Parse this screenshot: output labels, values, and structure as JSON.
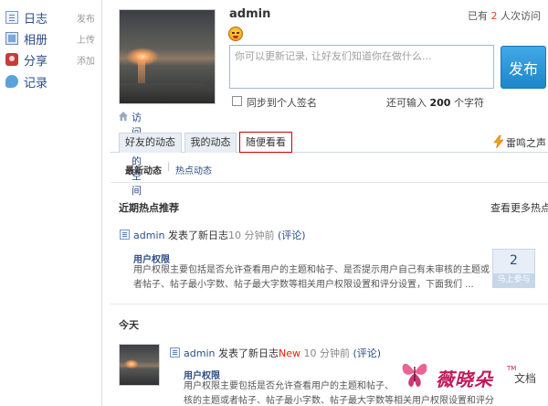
{
  "sidebar": {
    "items": [
      {
        "label": "日志",
        "action": "发布",
        "icon": "blog-icon"
      },
      {
        "label": "相册",
        "action": "上传",
        "icon": "album-icon"
      },
      {
        "label": "分享",
        "action": "添加",
        "icon": "share-icon"
      },
      {
        "label": "记录",
        "action": "",
        "icon": "record-icon"
      }
    ]
  },
  "profile": {
    "username": "admin",
    "visit_space": "访问我的空间",
    "visitors_prefix": "已有",
    "visitors_count": "2",
    "visitors_suffix": "人次访问"
  },
  "status": {
    "placeholder": "你可以更新记录, 让好友们知道你在做什么...",
    "publish_label": "发布",
    "sync_label": "同步到个人签名",
    "char_prefix": "还可输入",
    "char_count": "200",
    "char_suffix": "个字符"
  },
  "tabs": {
    "friends": "好友的动态",
    "mine": "我的动态",
    "random": "随便看看",
    "thunder": "雷鸣之声"
  },
  "subtabs": {
    "latest": "最新动态",
    "separator": "|",
    "hot": "热点动态"
  },
  "hot_section": {
    "title": "近期热点推荐",
    "more": "查看更多热点",
    "feed": {
      "user": "admin",
      "action": "发表了新日志",
      "time": "10 分钟前",
      "comment": "(评论)",
      "post_title": "用户权限",
      "post_body_1": "用户权限主要包括是否允许查看用户的主题和帖子、是否提示用户自己有未审核的主题或",
      "post_body_2": "者帖子、帖子最小字数、帖子最大字数等相关用户权限设置和评分设置，下面我们 ...",
      "vote_count": "2",
      "vote_label": "马上参与"
    }
  },
  "today_section": {
    "title": "今天",
    "feed": {
      "user": "admin",
      "action": "发表了新日志",
      "new_tag": "New",
      "time": "10 分钟前",
      "comment": "(评论)",
      "post_title": "用户权限",
      "post_body_1": "用户权限主要包括是否允许查看用户的主题和帖子、",
      "post_body_2": "核的主题或者帖子、帖子最小字数、帖子最大字数等相关用户权限设置和评分"
    }
  },
  "watermark": {
    "text": "薇晓朵",
    "tm": "TM",
    "doc": "文档"
  }
}
